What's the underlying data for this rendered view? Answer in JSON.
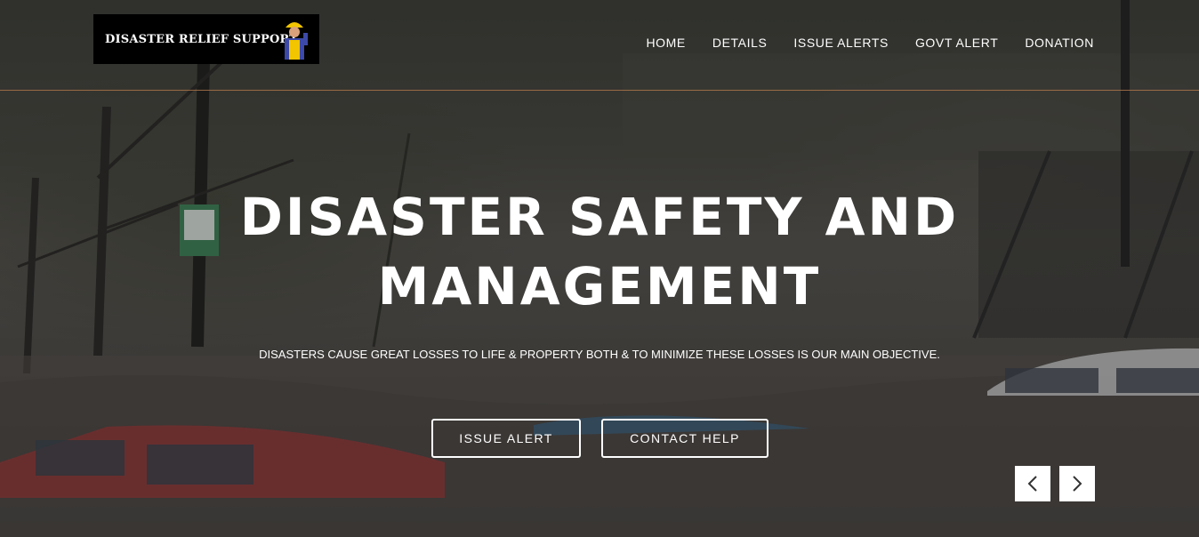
{
  "brand": {
    "logo_text": "DISASTER RELIEF SUPPORT"
  },
  "nav": {
    "items": [
      {
        "label": "HOME"
      },
      {
        "label": "DETAILS"
      },
      {
        "label": "ISSUE ALERTS"
      },
      {
        "label": "GOVT ALERT"
      },
      {
        "label": "DONATION"
      }
    ]
  },
  "hero": {
    "title_line1": "DISASTER SAFETY AND",
    "title_line2": "MANAGEMENT",
    "subtitle": "DISASTERS CAUSE GREAT LOSSES TO LIFE & PROPERTY BOTH & TO MINIMIZE THESE LOSSES IS OUR MAIN OBJECTIVE.",
    "primary_button": "ISSUE ALERT",
    "secondary_button": "CONTACT HELP"
  },
  "carousel": {
    "prev_icon": "chevron-left-icon",
    "next_icon": "chevron-right-icon"
  },
  "colors": {
    "accent_line": "#b3784a",
    "logo_background": "#000000",
    "text": "#ffffff"
  }
}
